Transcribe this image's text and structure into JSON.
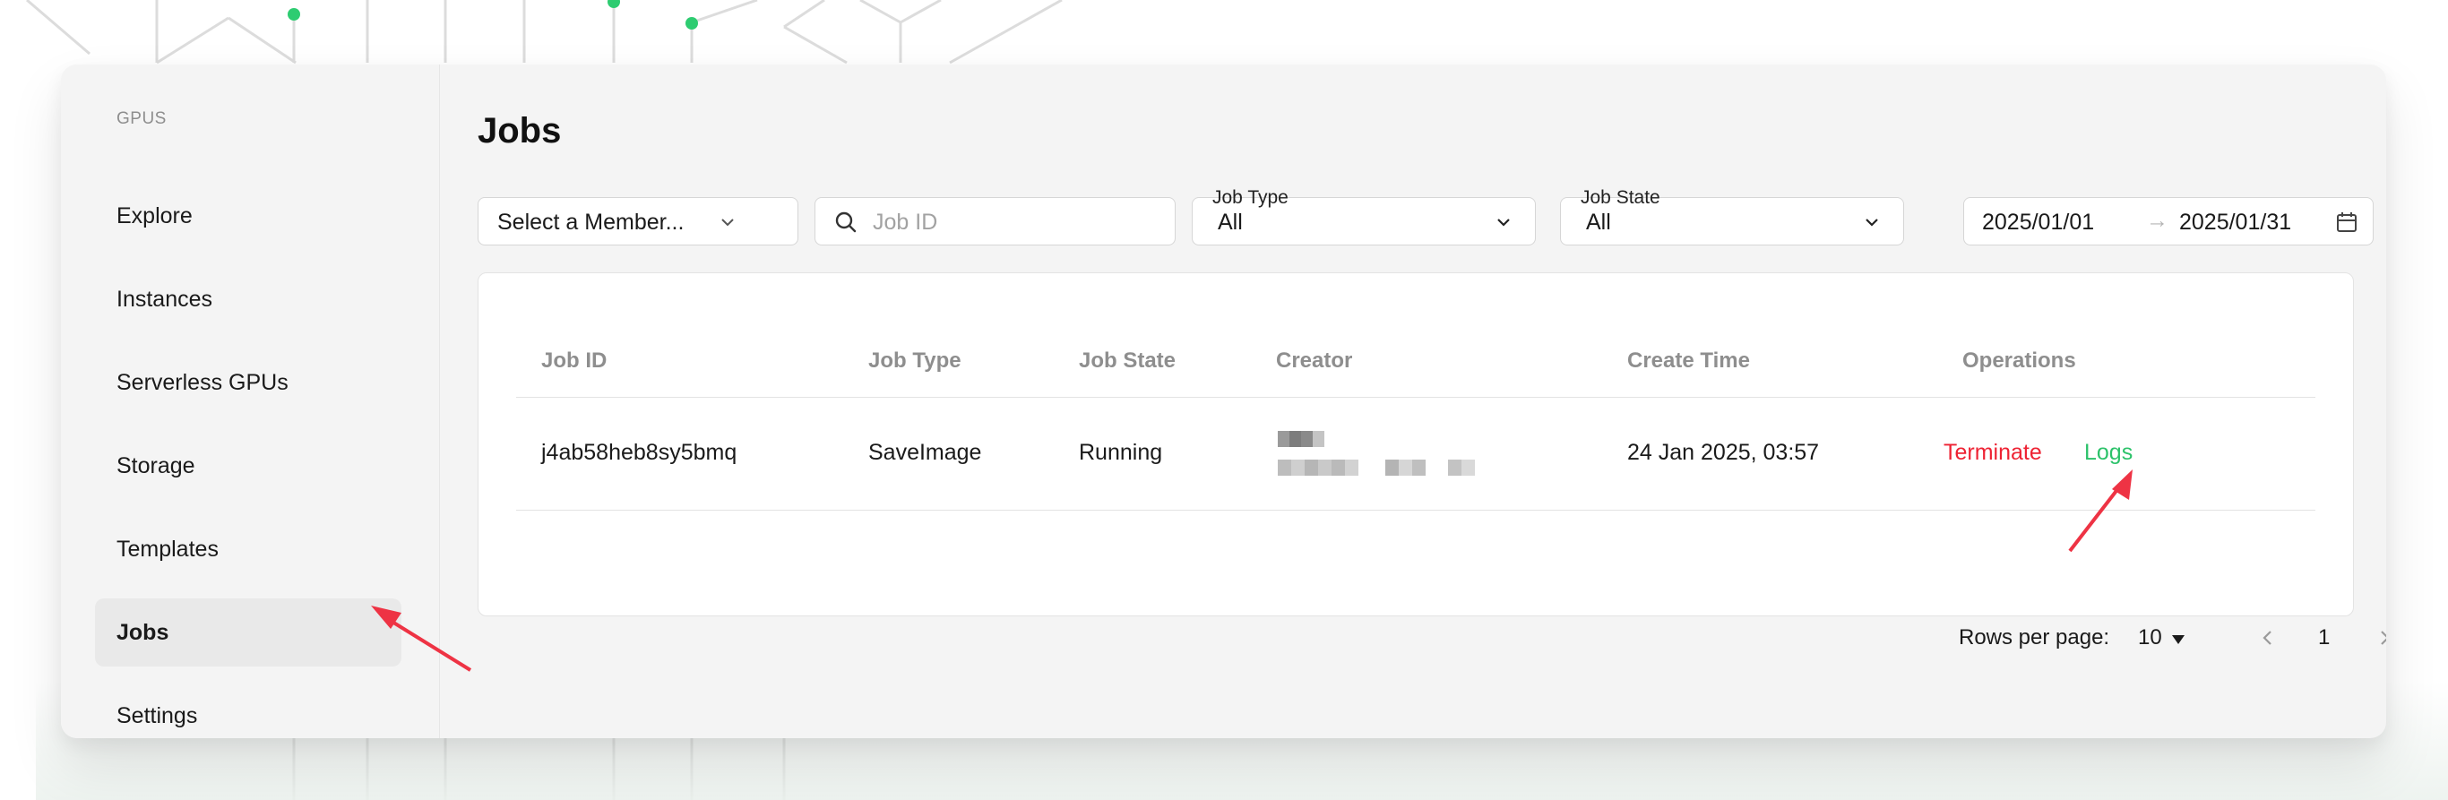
{
  "sidebar": {
    "section_label": "GPUS",
    "items": [
      {
        "label": "Explore"
      },
      {
        "label": "Instances"
      },
      {
        "label": "Serverless GPUs"
      },
      {
        "label": "Storage"
      },
      {
        "label": "Templates"
      },
      {
        "label": "Jobs",
        "active": true
      },
      {
        "label": "Settings"
      }
    ]
  },
  "main": {
    "title": "Jobs",
    "filters": {
      "member_select": {
        "value": "Select a Member..."
      },
      "job_id_search": {
        "placeholder": "Job ID",
        "value": ""
      },
      "job_type": {
        "label": "Job Type",
        "value": "All"
      },
      "job_state": {
        "label": "Job State",
        "value": "All"
      },
      "date_range": {
        "start": "2025/01/01",
        "separator": "→",
        "end": "2025/01/31"
      }
    },
    "table": {
      "headers": [
        "Job ID",
        "Job Type",
        "Job State",
        "Creator",
        "Create Time",
        "Operations"
      ],
      "rows": [
        {
          "job_id": "j4ab58heb8sy5bmq",
          "job_type": "SaveImage",
          "job_state": "Running",
          "create_time": "24 Jan 2025, 03:57",
          "operations": {
            "terminate": "Terminate",
            "logs": "Logs"
          }
        }
      ]
    },
    "pagination": {
      "rows_per_page_label": "Rows per page:",
      "rows_per_page": "10",
      "current_page": "1"
    }
  },
  "colors": {
    "terminate": "#ee2233",
    "logs": "#2cc26a",
    "annotation_arrow": "#ee3344",
    "background_dots": "#2ecc71"
  },
  "icons": [
    "chevron-down-icon",
    "search-icon",
    "calendar-icon",
    "chevron-left-icon",
    "chevron-right-icon",
    "caret-down-icon"
  ]
}
